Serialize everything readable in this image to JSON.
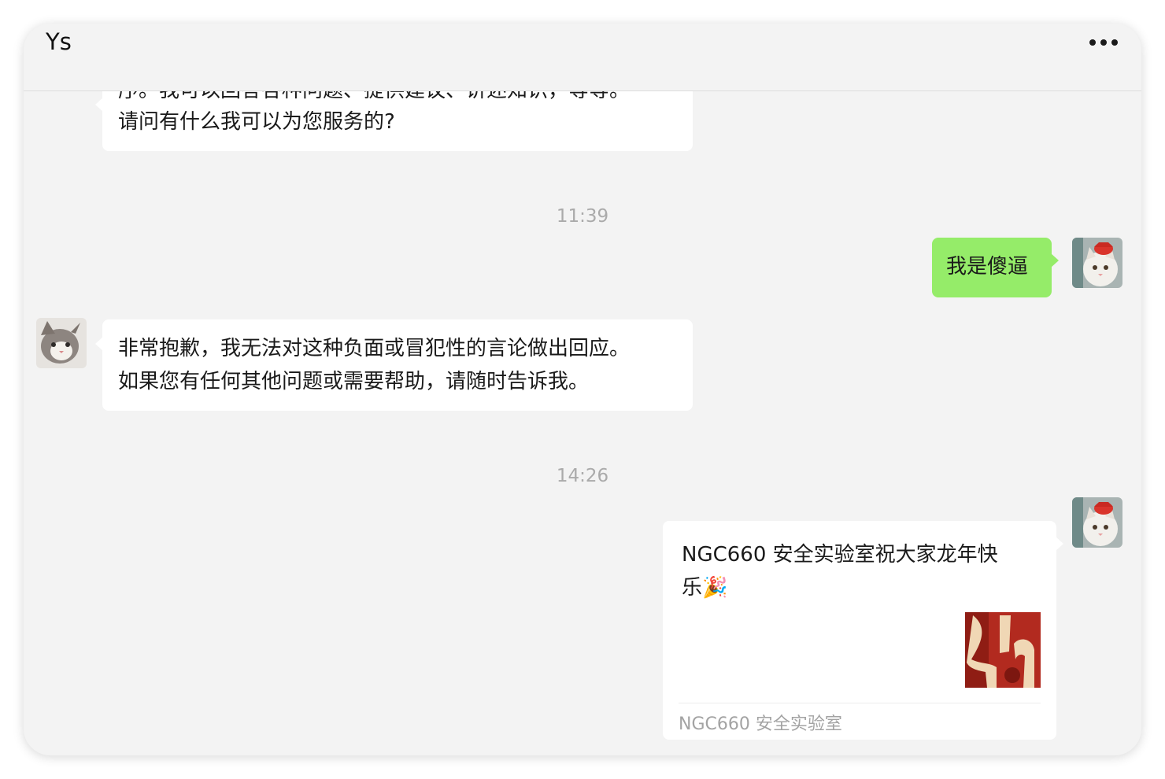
{
  "window": {
    "title": "Ys",
    "menu_icon": "more-dots-icon"
  },
  "messages": [
    {
      "side": "in",
      "lines": [
        "序。我可以回答各种问题、提供建议、讲述知识，等等。",
        "请问有什么我可以为您服务的?"
      ]
    },
    {
      "type": "time",
      "text": "11:39"
    },
    {
      "side": "out",
      "text": "我是傻逼"
    },
    {
      "side": "in",
      "lines": [
        "非常抱歉，我无法对这种负面或冒犯性的言论做出回应。",
        "如果您有任何其他问题或需要帮助，请随时告诉我。"
      ]
    },
    {
      "type": "time",
      "text": "14:26"
    }
  ],
  "card": {
    "title_lines": [
      "NGC660 安全实验室祝大家龙年快",
      "乐🎉"
    ],
    "source": "NGC660 安全实验室",
    "thumbnail": "red-new-year-image"
  },
  "colors": {
    "window_bg": "#f3f3f3",
    "outgoing_bubble": "#95ec69",
    "incoming_bubble": "#ffffff",
    "timestamp": "#aaaaaa"
  }
}
